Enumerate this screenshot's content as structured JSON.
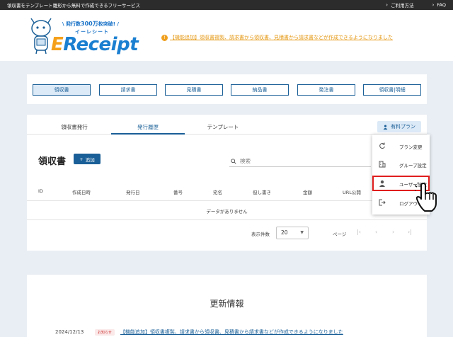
{
  "topbar": {
    "tagline": "領収書をテンプレート雛形から無料で作成できるフリーサービス",
    "usage_link": "ご利用方法",
    "faq_link": "FAQ"
  },
  "logo": {
    "badge_prefix": "発行数",
    "badge_number": "300万",
    "badge_suffix": "枚突破!",
    "kana": "イーレシート",
    "word_e": "E",
    "word_rest": "Receipt"
  },
  "announcement": "【機能追加】領収書複製、請求書から領収書、見積書から請求書などが作成できるようになりました",
  "doc_types": [
    "領収書",
    "請求書",
    "見積書",
    "納品書",
    "発注書",
    "領収書|明細"
  ],
  "tabs": [
    "領収書発行",
    "発行履歴",
    "テンプレート"
  ],
  "paid_plan": "有料プラン",
  "section_title": "領収書",
  "add_button": "追加",
  "search": {
    "placeholder": "検索"
  },
  "table": {
    "columns": [
      "ID",
      "作成日時",
      "発行日",
      "番号",
      "宛名",
      "但し書き",
      "金額",
      "URL公開"
    ],
    "empty_message": "データがありません"
  },
  "pagination": {
    "rows_label": "表示件数",
    "rows_value": "20",
    "page_label": "ページ"
  },
  "menu": {
    "items": [
      {
        "label": "プラン変更",
        "icon": "refresh-icon"
      },
      {
        "label": "グループ設定",
        "icon": "building-icon"
      },
      {
        "label": "ユーザー設定",
        "icon": "person-icon"
      },
      {
        "label": "ログアウト",
        "icon": "logout-icon"
      }
    ]
  },
  "news": {
    "title": "更新情報",
    "date": "2024/12/13",
    "tag": "お知らせ",
    "text": "【機能追加】領収書複製、請求書から領収書、見積書から請求書などが作成できるようになりました"
  },
  "colors": {
    "primary": "#1a5f97",
    "accent_orange": "#e59a17",
    "highlight_red": "#e01e1e",
    "background": "#e9eef4"
  }
}
